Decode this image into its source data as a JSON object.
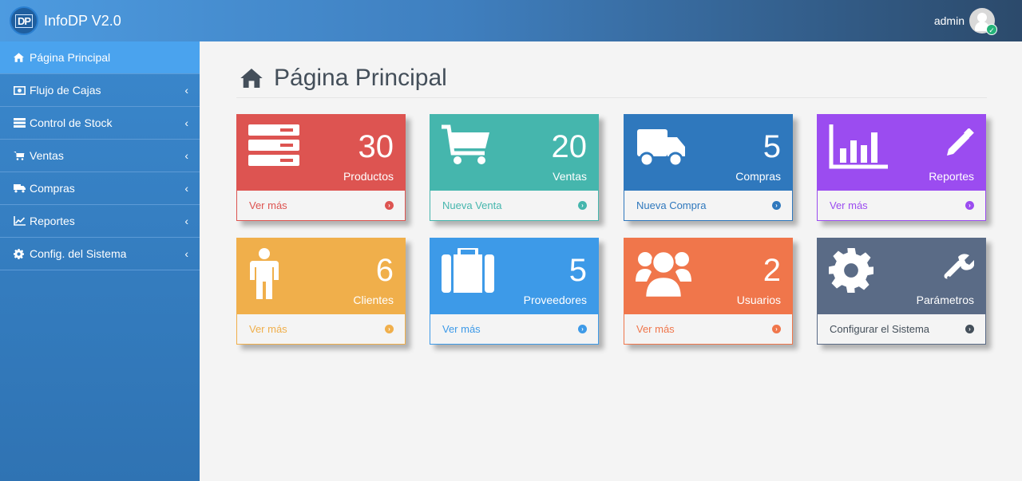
{
  "app": {
    "logo_text": "DP",
    "title": "InfoDP V2.0"
  },
  "user": {
    "name": "admin"
  },
  "sidebar": {
    "items": [
      {
        "label": "Página Principal",
        "icon": "home-icon",
        "active": true
      },
      {
        "label": "Flujo de Cajas",
        "icon": "money-icon"
      },
      {
        "label": "Control de Stock",
        "icon": "server-icon"
      },
      {
        "label": "Ventas",
        "icon": "cart-icon"
      },
      {
        "label": "Compras",
        "icon": "truck-icon"
      },
      {
        "label": "Reportes",
        "icon": "line-chart-icon"
      },
      {
        "label": "Config. del Sistema",
        "icon": "gear-icon"
      }
    ],
    "chevron": "‹"
  },
  "page": {
    "title": "Página Principal"
  },
  "boxes": [
    {
      "count": "30",
      "label": "Productos",
      "link": "Ver más",
      "color": "#dd5451",
      "icon": "server-icon"
    },
    {
      "count": "20",
      "label": "Ventas",
      "link": "Nueva Venta",
      "color": "#45b6ad",
      "icon": "cart-icon"
    },
    {
      "count": "5",
      "label": "Compras",
      "link": "Nueva Compra",
      "color": "#2f78bd",
      "icon": "truck-icon"
    },
    {
      "count": "",
      "label": "Reportes",
      "link": "Ver más",
      "color": "#9b4cf0",
      "icon": "bar-chart-icon"
    },
    {
      "count": "6",
      "label": "Clientes",
      "link": "Ver más",
      "color": "#f0af4b",
      "icon": "male-icon"
    },
    {
      "count": "5",
      "label": "Proveedores",
      "link": "Ver más",
      "color": "#3d9ae8",
      "icon": "briefcase-icon"
    },
    {
      "count": "2",
      "label": "Usuarios",
      "link": "Ver más",
      "color": "#f0764b",
      "icon": "users-icon"
    },
    {
      "count": "",
      "label": "Parámetros",
      "link": "Configurar el Sistema",
      "color": "#5a6b86",
      "icon": "gear-icon"
    }
  ]
}
